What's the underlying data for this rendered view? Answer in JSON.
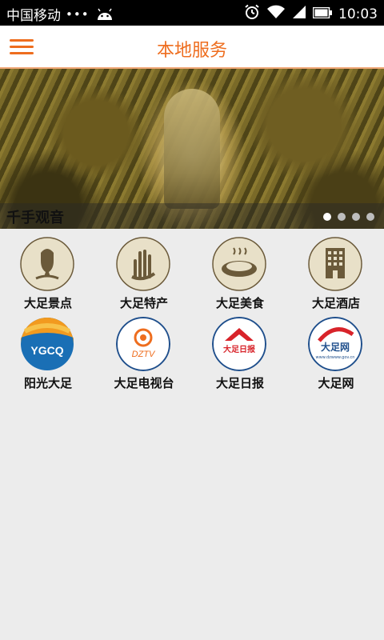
{
  "status_bar": {
    "carrier": "中国移动",
    "dots": "•••",
    "time": "10:03"
  },
  "app_bar": {
    "title": "本地服务",
    "menu_icon": "hamburger-menu-icon"
  },
  "banner": {
    "caption": "千手观音",
    "page_count": 4,
    "active_page": 1
  },
  "grid": {
    "items": [
      {
        "label": "大足景点",
        "icon": "buddha-head-icon"
      },
      {
        "label": "大足特产",
        "icon": "hand-plant-icon"
      },
      {
        "label": "大足美食",
        "icon": "food-bowl-icon"
      },
      {
        "label": "大足酒店",
        "icon": "hotel-building-icon"
      },
      {
        "label": "阳光大足",
        "icon": "ygcq-logo",
        "logo_text": "YGCQ"
      },
      {
        "label": "大足电视台",
        "icon": "dztv-logo",
        "logo_text": "DZTV"
      },
      {
        "label": "大足日报",
        "icon": "daily-news-logo",
        "logo_text": "大足日报"
      },
      {
        "label": "大足网",
        "icon": "dazu-net-logo",
        "logo_text": "大足网",
        "logo_subtext": "www.dzwww.gov.cn"
      }
    ]
  },
  "colors": {
    "accent": "#ee6d1e",
    "icon_beige": "#e8e0c8",
    "icon_brown": "#6b5a3a",
    "background": "#ececec"
  }
}
